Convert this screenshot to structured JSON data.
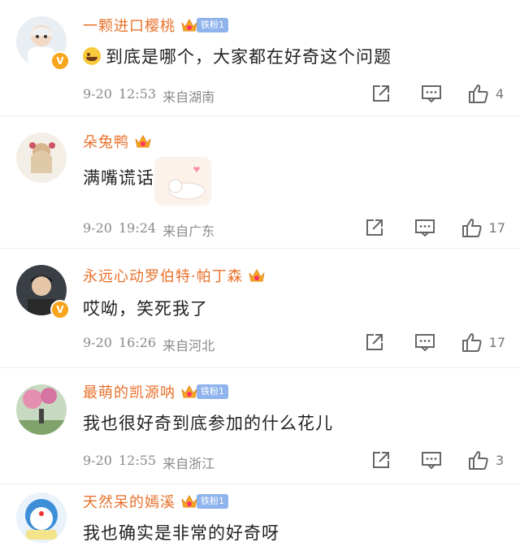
{
  "comments": [
    {
      "name": "一颗进口樱桃",
      "fan_badge": "铁粉1",
      "verified": true,
      "emoji": true,
      "text": "到底是哪个，大家都在好奇这个问题",
      "date": "9-20",
      "time": "12:53",
      "location": "来自湖南",
      "likes": "4"
    },
    {
      "name": "朵兔鸭",
      "fan_badge": "",
      "verified": false,
      "emoji": false,
      "sticker": true,
      "text": "满嘴谎话",
      "date": "9-20",
      "time": "19:24",
      "location": "来自广东",
      "likes": "17"
    },
    {
      "name": "永远心动罗伯特·帕丁森",
      "fan_badge": "",
      "verified": true,
      "emoji": false,
      "text": "哎呦，笑死我了",
      "date": "9-20",
      "time": "16:26",
      "location": "来自河北",
      "likes": "17"
    },
    {
      "name": "最萌的凯源呐",
      "fan_badge": "铁粉1",
      "verified": false,
      "emoji": false,
      "text": "我也很好奇到底参加的什么花儿",
      "date": "9-20",
      "time": "12:55",
      "location": "来自浙江",
      "likes": "3"
    },
    {
      "name": "天然呆的嫣溪",
      "fan_badge": "铁粉1",
      "verified": false,
      "emoji": false,
      "text": "我也确实是非常的好奇呀",
      "date": "",
      "time": "",
      "location": "",
      "likes": ""
    }
  ],
  "icons": {
    "share": "share-icon",
    "comment": "comment-icon",
    "like": "thumbs-up-icon",
    "crown": "crown-icon"
  },
  "colors": {
    "name": "#e8712b",
    "fan_badge": "#8fb3ec",
    "meta": "#8a8a8a",
    "verified": "#f7a51c"
  }
}
